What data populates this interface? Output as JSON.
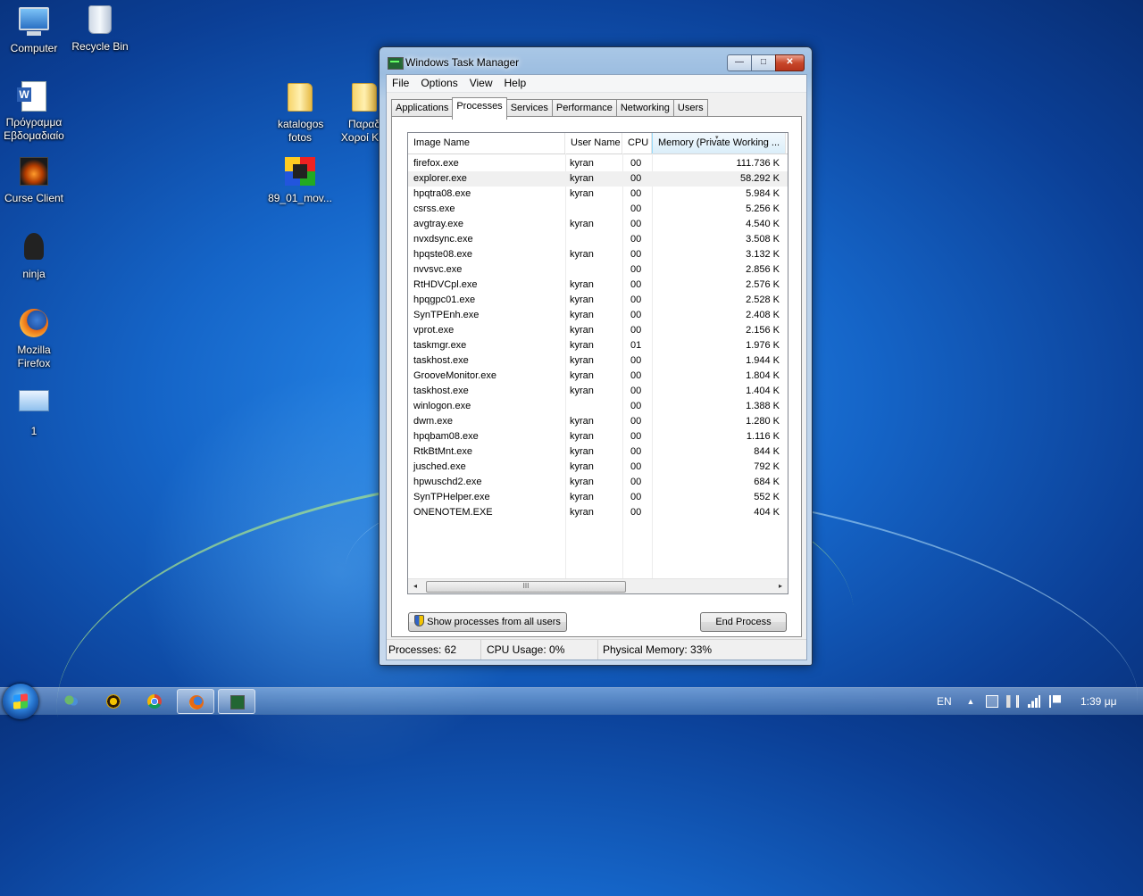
{
  "desktop": {
    "icons": [
      {
        "label": "Computer"
      },
      {
        "label": "Recycle Bin"
      },
      {
        "label": "Πρόγραμμα Εβδομαδιαίο"
      },
      {
        "label": "Curse Client"
      },
      {
        "label": "ninja"
      },
      {
        "label": "Mozilla Firefox"
      },
      {
        "label": "1"
      },
      {
        "label": "katalogos fotos"
      },
      {
        "label": "Παραδ Χοροί Κ..."
      },
      {
        "label": "89_01_mov..."
      }
    ]
  },
  "window": {
    "title": "Windows Task Manager",
    "buttons": {
      "minimize": "—",
      "maximize": "□",
      "close": "✕"
    },
    "menu": [
      "File",
      "Options",
      "View",
      "Help"
    ],
    "tabs": [
      "Applications",
      "Processes",
      "Services",
      "Performance",
      "Networking",
      "Users"
    ],
    "active_tab": "Processes",
    "columns": [
      "Image Name",
      "User Name",
      "CPU",
      "Memory (Private Working ..."
    ],
    "processes": [
      {
        "name": "firefox.exe",
        "user": "kyran",
        "cpu": "00",
        "mem": "111.736 K"
      },
      {
        "name": "explorer.exe",
        "user": "kyran",
        "cpu": "00",
        "mem": "58.292 K"
      },
      {
        "name": "hpqtra08.exe",
        "user": "kyran",
        "cpu": "00",
        "mem": "5.984 K"
      },
      {
        "name": "csrss.exe",
        "user": "",
        "cpu": "00",
        "mem": "5.256 K"
      },
      {
        "name": "avgtray.exe",
        "user": "kyran",
        "cpu": "00",
        "mem": "4.540 K"
      },
      {
        "name": "nvxdsync.exe",
        "user": "",
        "cpu": "00",
        "mem": "3.508 K"
      },
      {
        "name": "hpqste08.exe",
        "user": "kyran",
        "cpu": "00",
        "mem": "3.132 K"
      },
      {
        "name": "nvvsvc.exe",
        "user": "",
        "cpu": "00",
        "mem": "2.856 K"
      },
      {
        "name": "RtHDVCpl.exe",
        "user": "kyran",
        "cpu": "00",
        "mem": "2.576 K"
      },
      {
        "name": "hpqgpc01.exe",
        "user": "kyran",
        "cpu": "00",
        "mem": "2.528 K"
      },
      {
        "name": "SynTPEnh.exe",
        "user": "kyran",
        "cpu": "00",
        "mem": "2.408 K"
      },
      {
        "name": "vprot.exe",
        "user": "kyran",
        "cpu": "00",
        "mem": "2.156 K"
      },
      {
        "name": "taskmgr.exe",
        "user": "kyran",
        "cpu": "01",
        "mem": "1.976 K"
      },
      {
        "name": "taskhost.exe",
        "user": "kyran",
        "cpu": "00",
        "mem": "1.944 K"
      },
      {
        "name": "GrooveMonitor.exe",
        "user": "kyran",
        "cpu": "00",
        "mem": "1.804 K"
      },
      {
        "name": "taskhost.exe",
        "user": "kyran",
        "cpu": "00",
        "mem": "1.404 K"
      },
      {
        "name": "winlogon.exe",
        "user": "",
        "cpu": "00",
        "mem": "1.388 K"
      },
      {
        "name": "dwm.exe",
        "user": "kyran",
        "cpu": "00",
        "mem": "1.280 K"
      },
      {
        "name": "hpqbam08.exe",
        "user": "kyran",
        "cpu": "00",
        "mem": "1.116 K"
      },
      {
        "name": "RtkBtMnt.exe",
        "user": "kyran",
        "cpu": "00",
        "mem": "844 K"
      },
      {
        "name": "jusched.exe",
        "user": "kyran",
        "cpu": "00",
        "mem": "792 K"
      },
      {
        "name": "hpwuschd2.exe",
        "user": "kyran",
        "cpu": "00",
        "mem": "684 K"
      },
      {
        "name": "SynTPHelper.exe",
        "user": "kyran",
        "cpu": "00",
        "mem": "552 K"
      },
      {
        "name": "ONENOTEM.EXE",
        "user": "kyran",
        "cpu": "00",
        "mem": "404 K"
      }
    ],
    "scrollbar": {
      "left": "◂",
      "right": "▸",
      "grip": "III"
    },
    "show_all_label": "Show processes from all users",
    "end_process_label": "End Process",
    "status": {
      "processes": "Processes: 62",
      "cpu": "CPU Usage: 0%",
      "memory": "Physical Memory: 33%"
    }
  },
  "taskbar": {
    "items": [
      "people-app",
      "world-of-warcraft",
      "google-chrome",
      "mozilla-firefox",
      "task-manager"
    ],
    "tray": {
      "language": "EN",
      "arrow": "▲",
      "clock": "1:39 μμ"
    }
  }
}
